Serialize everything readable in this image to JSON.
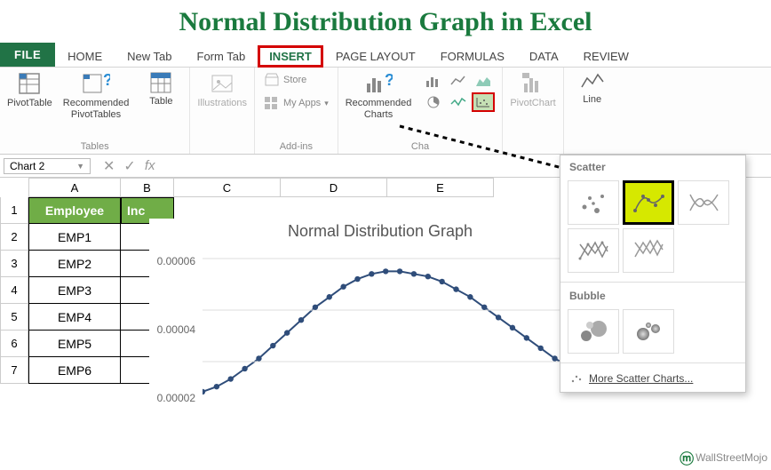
{
  "banner": {
    "title": "Normal Distribution Graph in Excel"
  },
  "tabs": {
    "file": "FILE",
    "home": "HOME",
    "newtab": "New Tab",
    "formtab": "Form Tab",
    "insert": "INSERT",
    "pagelayout": "PAGE LAYOUT",
    "formulas": "FORMULAS",
    "data": "DATA",
    "review": "REVIEW"
  },
  "ribbon": {
    "tables": {
      "pivottable": "PivotTable",
      "recpivot": "Recommended\nPivotTables",
      "table": "Table",
      "label": "Tables"
    },
    "illustrations": "Illustrations",
    "addins": {
      "store": "Store",
      "myapps": "My Apps",
      "label": "Add-ins"
    },
    "charts": {
      "rec": "Recommended\nCharts",
      "label": "Cha"
    },
    "pivotchart": "PivotChart",
    "line": "Line"
  },
  "namebox": {
    "value": "Chart 2"
  },
  "formula_bar": {
    "fx": "fx"
  },
  "columns": [
    "A",
    "B",
    "C",
    "D",
    "E"
  ],
  "table": {
    "headerA": "Employee",
    "headerB": "Inc",
    "rows": [
      {
        "n": "1",
        "a": "Employee",
        "b": "Inc"
      },
      {
        "n": "2",
        "a": "EMP1",
        "b": ""
      },
      {
        "n": "3",
        "a": "EMP2",
        "b": ""
      },
      {
        "n": "4",
        "a": "EMP3",
        "b": ""
      },
      {
        "n": "5",
        "a": "EMP4",
        "b": ""
      },
      {
        "n": "6",
        "a": "EMP5",
        "b": ""
      },
      {
        "n": "7",
        "a": "EMP6",
        "b": ""
      }
    ]
  },
  "chart_embed": {
    "title": "Normal Distribution Graph",
    "y_ticks": [
      "0.00006",
      "0.00004",
      "0.00002"
    ]
  },
  "popup": {
    "scatter_title": "Scatter",
    "bubble_title": "Bubble",
    "more": "More Scatter Charts..."
  },
  "watermark": "WallStreetMojo",
  "chart_data": {
    "type": "line",
    "title": "Normal Distribution Graph",
    "xlabel": "",
    "ylabel": "",
    "ylim": [
      0,
      6e-05
    ],
    "x": [
      0,
      1,
      2,
      3,
      4,
      5,
      6,
      7,
      8,
      9,
      10,
      11,
      12,
      13,
      14,
      15,
      16,
      17,
      18,
      19,
      20,
      21,
      22,
      23,
      24,
      25,
      26,
      27,
      28,
      29
    ],
    "values": [
      8e-06,
      1e-05,
      1.3e-05,
      1.7e-05,
      2.1e-05,
      2.6e-05,
      3.1e-05,
      3.6e-05,
      4.1e-05,
      4.5e-05,
      4.9e-05,
      5.2e-05,
      5.4e-05,
      5.5e-05,
      5.5e-05,
      5.4e-05,
      5.3e-05,
      5.1e-05,
      4.8e-05,
      4.5e-05,
      4.1e-05,
      3.7e-05,
      3.3e-05,
      2.9e-05,
      2.5e-05,
      2.1e-05,
      1.8e-05,
      1.5e-05,
      1.2e-05,
      1e-05
    ]
  }
}
